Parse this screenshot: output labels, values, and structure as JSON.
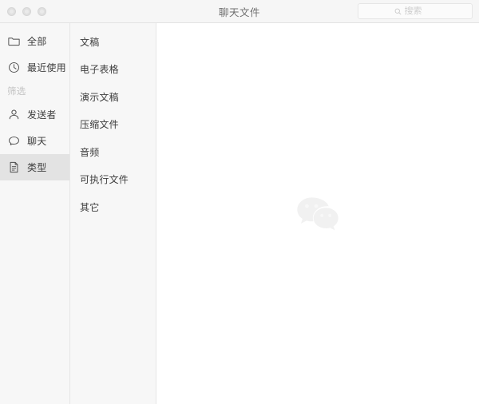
{
  "window": {
    "title": "聊天文件",
    "traffic_lights": [
      "close-button",
      "minimize-button",
      "zoom-button"
    ]
  },
  "search": {
    "placeholder": "搜索",
    "value": "",
    "icon": "search-icon"
  },
  "sidebar": {
    "items": [
      {
        "label": "全部",
        "icon": "folder-icon",
        "selected": false
      },
      {
        "label": "最近使用",
        "icon": "clock-icon",
        "selected": false
      }
    ],
    "section_label": "筛选",
    "filter_items": [
      {
        "label": "发送者",
        "icon": "person-icon",
        "selected": false
      },
      {
        "label": "聊天",
        "icon": "chat-bubble-icon",
        "selected": false
      },
      {
        "label": "类型",
        "icon": "document-icon",
        "selected": true
      }
    ]
  },
  "types": {
    "items": [
      {
        "label": "文稿",
        "selected": false
      },
      {
        "label": "电子表格",
        "selected": false
      },
      {
        "label": "演示文稿",
        "selected": false
      },
      {
        "label": "压缩文件",
        "selected": false
      },
      {
        "label": "音频",
        "selected": false
      },
      {
        "label": "可执行文件",
        "selected": false
      },
      {
        "label": "其它",
        "selected": false
      }
    ]
  },
  "content": {
    "watermark_icon": "wechat-logo-watermark",
    "empty_text": ""
  },
  "colors": {
    "titlebar_bg": "#f6f6f6",
    "sidebar_bg": "#f7f7f7",
    "selected_bg": "#e3e3e3",
    "divider": "#e6e6e6",
    "text_primary": "#3d3d3d",
    "text_muted": "#c3c3c3",
    "content_bg": "#ffffff",
    "watermark": "#f2f2f2"
  }
}
